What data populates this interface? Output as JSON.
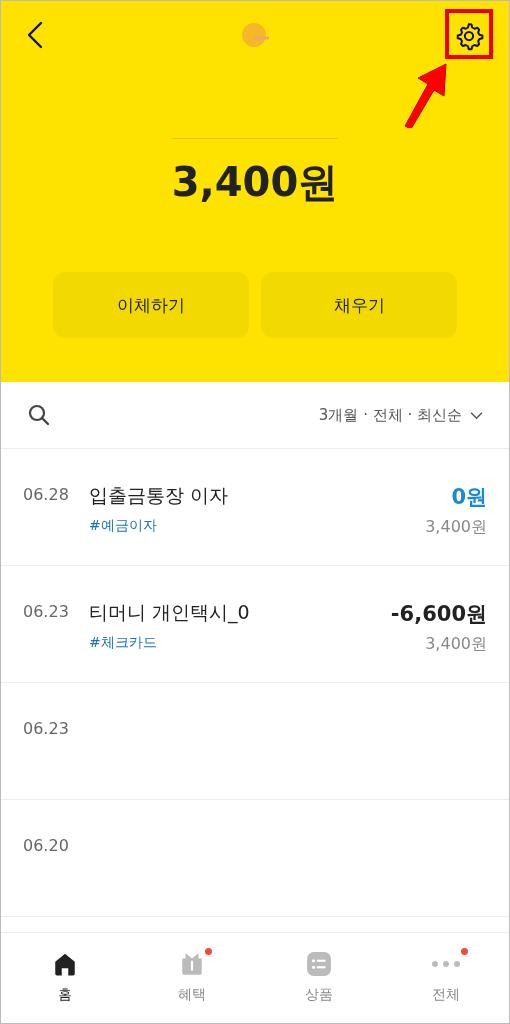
{
  "header": {
    "balance": "3,400원"
  },
  "actions": [
    {
      "label": "이체하기"
    },
    {
      "label": "채우기"
    }
  ],
  "filter": {
    "label": "3개월 · 전체 · 최신순"
  },
  "transactions": [
    {
      "date": "06.28",
      "title": "입출금통장 이자",
      "tag": "#예금이자",
      "amount": "0원",
      "kind": "deposit",
      "balance": "3,400원"
    },
    {
      "date": "06.23",
      "title": "티머니 개인택시_0",
      "tag": "#체크카드",
      "amount": "-6,600원",
      "kind": "withdrawal",
      "balance": "3,400원"
    },
    {
      "date": "06.23"
    },
    {
      "date": "06.20"
    }
  ],
  "nav": [
    {
      "label": "홈",
      "kind": "home",
      "selected": true,
      "badge": false
    },
    {
      "label": "혜택",
      "kind": "gift",
      "selected": false,
      "badge": true
    },
    {
      "label": "상품",
      "kind": "list",
      "selected": false,
      "badge": false
    },
    {
      "label": "전체",
      "kind": "more",
      "selected": false,
      "badge": true
    }
  ],
  "annotation": {
    "highlight": true
  }
}
